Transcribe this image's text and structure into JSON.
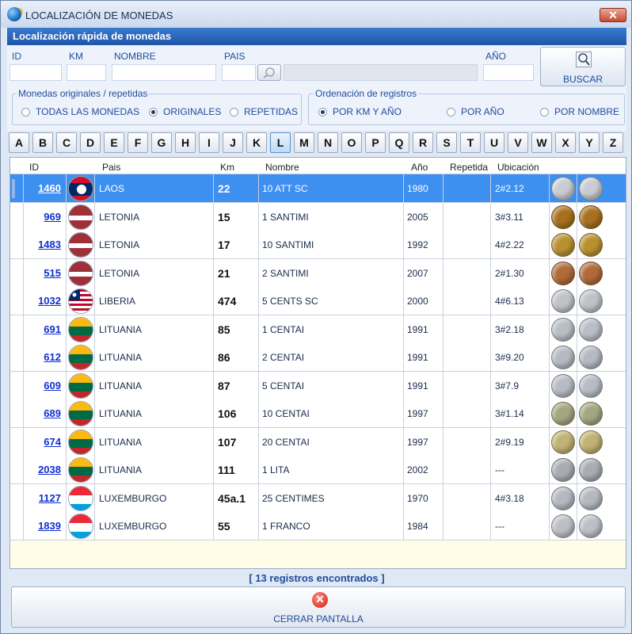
{
  "window": {
    "title": "LOCALIZACIÓN DE MONEDAS",
    "close_glyph": "✕",
    "icon": "globe-coin-icon"
  },
  "header": {
    "title": "Localización rápida de monedas"
  },
  "filters": {
    "id_label": "ID",
    "km_label": "KM",
    "nombre_label": "NOMBRE",
    "pais_label": "PAIS",
    "ano_label": "AÑO",
    "id_value": "",
    "km_value": "",
    "nombre_value": "",
    "pais_value": "",
    "pais_name_value": "",
    "ano_value": "",
    "search_button": "BUSCAR"
  },
  "group_monedas": {
    "title": "Monedas originales / repetidas",
    "options": [
      "TODAS LAS MONEDAS",
      "ORIGINALES",
      "REPETIDAS"
    ],
    "selected": "ORIGINALES"
  },
  "group_orden": {
    "title": "Ordenación de registros",
    "options": [
      "POR KM Y AÑO",
      "POR AÑO",
      "POR NOMBRE"
    ],
    "selected": "POR KM Y AÑO"
  },
  "letters": [
    "A",
    "B",
    "C",
    "D",
    "E",
    "F",
    "G",
    "H",
    "I",
    "J",
    "K",
    "L",
    "M",
    "N",
    "O",
    "P",
    "Q",
    "R",
    "S",
    "T",
    "U",
    "V",
    "W",
    "X",
    "Y",
    "Z"
  ],
  "selected_letter": "L",
  "table": {
    "columns": {
      "id": "ID",
      "pais": "Pais",
      "km": "Km",
      "nombre": "Nombre",
      "ano": "Año",
      "repetida": "Repetida",
      "ubicacion": "Ubicación"
    },
    "rows": [
      {
        "id": "1460",
        "pais": "LAOS",
        "km": "22",
        "nombre": "10 ATT SC",
        "ano": "1980",
        "repetida": "",
        "ubicacion": "2#2.12",
        "flag": "laos",
        "coin": "#c9ccd2"
      },
      {
        "id": "969",
        "pais": "LETONIA",
        "km": "15",
        "nombre": "1 SANTIMI",
        "ano": "2005",
        "repetida": "",
        "ubicacion": "3#3.11",
        "flag": "latvia",
        "coin": "#a8701e"
      },
      {
        "id": "1483",
        "pais": "LETONIA",
        "km": "17",
        "nombre": "10 SANTIMI",
        "ano": "1992",
        "repetida": "",
        "ubicacion": "4#2.22",
        "flag": "latvia",
        "coin": "#b89030"
      },
      {
        "id": "515",
        "pais": "LETONIA",
        "km": "21",
        "nombre": "2 SANTIMI",
        "ano": "2007",
        "repetida": "",
        "ubicacion": "2#1.30",
        "flag": "latvia",
        "coin": "#b06a3a"
      },
      {
        "id": "1032",
        "pais": "LIBERIA",
        "km": "474",
        "nombre": "5 CENTS SC",
        "ano": "2000",
        "repetida": "",
        "ubicacion": "4#6.13",
        "flag": "liberia",
        "coin": "#bfc3c8"
      },
      {
        "id": "691",
        "pais": "LITUANIA",
        "km": "85",
        "nombre": "1 CENTAI",
        "ano": "1991",
        "repetida": "",
        "ubicacion": "3#2.18",
        "flag": "lithuania",
        "coin": "#b9bec6"
      },
      {
        "id": "612",
        "pais": "LITUANIA",
        "km": "86",
        "nombre": "2 CENTAI",
        "ano": "1991",
        "repetida": "",
        "ubicacion": "3#9.20",
        "flag": "lithuania",
        "coin": "#b5bac2"
      },
      {
        "id": "609",
        "pais": "LITUANIA",
        "km": "87",
        "nombre": "5 CENTAI",
        "ano": "1991",
        "repetida": "",
        "ubicacion": "3#7.9",
        "flag": "lithuania",
        "coin": "#b7bcc4"
      },
      {
        "id": "689",
        "pais": "LITUANIA",
        "km": "106",
        "nombre": "10 CENTAI",
        "ano": "1997",
        "repetida": "",
        "ubicacion": "3#1.14",
        "flag": "lithuania",
        "coin": "#a4a680"
      },
      {
        "id": "674",
        "pais": "LITUANIA",
        "km": "107",
        "nombre": "20 CENTAI",
        "ano": "1997",
        "repetida": "",
        "ubicacion": "2#9.19",
        "flag": "lithuania",
        "coin": "#c0b272"
      },
      {
        "id": "2038",
        "pais": "LITUANIA",
        "km": "111",
        "nombre": "1 LITA",
        "ano": "2002",
        "repetida": "",
        "ubicacion": "---",
        "flag": "lithuania",
        "coin": "#a9adb3"
      },
      {
        "id": "1127",
        "pais": "LUXEMBURGO",
        "km": "45a.1",
        "nombre": "25 CENTIMES",
        "ano": "1970",
        "repetida": "",
        "ubicacion": "4#3.18",
        "flag": "luxembourg",
        "coin": "#b4b9c0"
      },
      {
        "id": "1839",
        "pais": "LUXEMBURGO",
        "km": "55",
        "nombre": "1 FRANCO",
        "ano": "1984",
        "repetida": "",
        "ubicacion": "---",
        "flag": "luxembourg",
        "coin": "#bcc0c6"
      }
    ]
  },
  "status": {
    "text": "[ 13 registros encontrados ]"
  },
  "footer": {
    "close_button": "CERRAR PANTALLA"
  }
}
